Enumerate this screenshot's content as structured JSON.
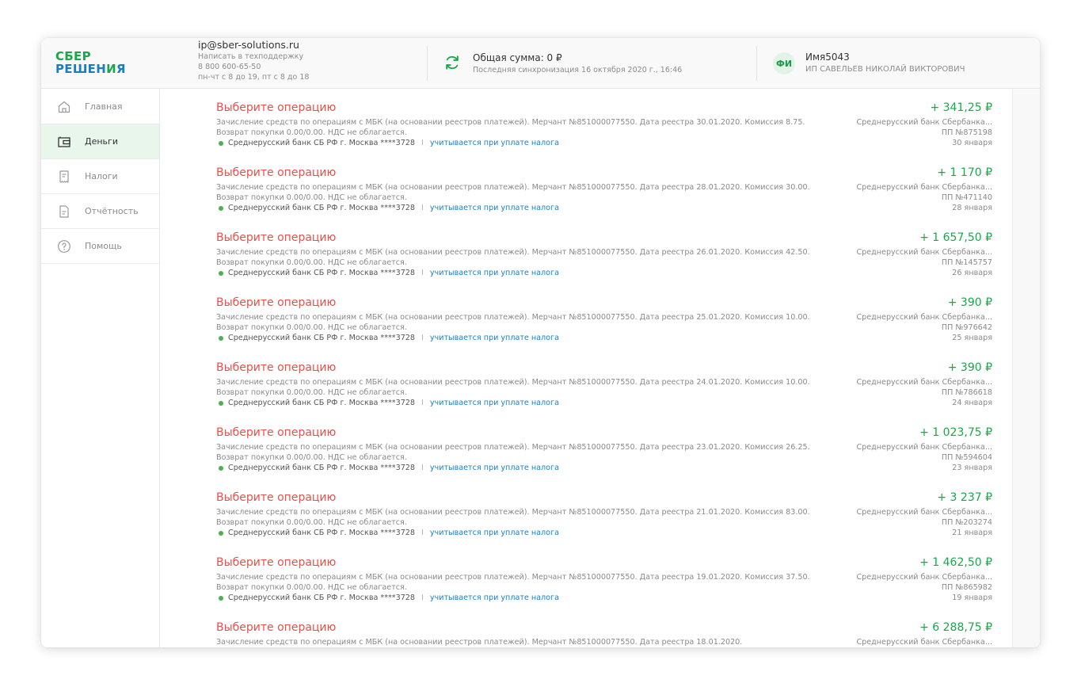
{
  "logo": {
    "line1": "СБЕР",
    "line2a": "РЕШЕН",
    "line2b": "И",
    "line2c": "Я"
  },
  "contacts": {
    "email": "ip@sber-solutions.ru",
    "support": "Написать в техподдержку",
    "phone": "8 800 600-65-50",
    "hours": "пн-чт с 8 до 19, пт с 8 до 18"
  },
  "sync": {
    "total": "Общая сумма: 0 ₽",
    "last": "Последняя синхронизация 16 октября 2020 г., 16:46"
  },
  "user": {
    "initials": "ФИ",
    "name": "Имя5043",
    "org": "ИП САВЕЛЬЕВ НИКОЛАЙ ВИКТОРОВИЧ"
  },
  "sidebar": {
    "items": [
      {
        "label": "Главная",
        "icon": "home-icon"
      },
      {
        "label": "Деньги",
        "icon": "wallet-icon"
      },
      {
        "label": "Налоги",
        "icon": "receipt-icon"
      },
      {
        "label": "Отчётность",
        "icon": "document-icon"
      },
      {
        "label": "Помощь",
        "icon": "help-icon"
      }
    ]
  },
  "colors": {
    "accent_green": "#18a84a",
    "title_red": "#e8504b",
    "link_blue": "#1a7fc1"
  },
  "operations": [
    {
      "title": "Выберите операцию",
      "desc": "Зачисление средств по операциям с МБК (на основании реестров платежей). Мерчант №851000077550. Дата реестра 30.01.2020. Комиссия 8.75. Возврат покупки 0.00/0.00. НДС не облагается.",
      "account": "Среднерусский банк СБ РФ г. Москва ****3728",
      "sep": "I",
      "tax": "учитывается при уплате налога",
      "amount": "+ 341,25 ₽",
      "bank": "Среднерусский банк Сбербанка...",
      "pp": "ПП №875198",
      "date": "30 января"
    },
    {
      "title": "Выберите операцию",
      "desc": "Зачисление средств по операциям с МБК (на основании реестров платежей). Мерчант №851000077550. Дата реестра 28.01.2020. Комиссия 30.00. Возврат покупки 0.00/0.00. НДС не облагается.",
      "account": "Среднерусский банк СБ РФ г. Москва ****3728",
      "sep": "I",
      "tax": "учитывается при уплате налога",
      "amount": "+ 1 170 ₽",
      "bank": "Среднерусский банк Сбербанка...",
      "pp": "ПП №471140",
      "date": "28 января"
    },
    {
      "title": "Выберите операцию",
      "desc": "Зачисление средств по операциям с МБК (на основании реестров платежей). Мерчант №851000077550. Дата реестра 26.01.2020. Комиссия 42.50. Возврат покупки 0.00/0.00. НДС не облагается.",
      "account": "Среднерусский банк СБ РФ г. Москва ****3728",
      "sep": "I",
      "tax": "учитывается при уплате налога",
      "amount": "+ 1 657,50 ₽",
      "bank": "Среднерусский банк Сбербанка...",
      "pp": "ПП №145757",
      "date": "26 января"
    },
    {
      "title": "Выберите операцию",
      "desc": "Зачисление средств по операциям с МБК (на основании реестров платежей). Мерчант №851000077550. Дата реестра 25.01.2020. Комиссия 10.00. Возврат покупки 0.00/0.00. НДС не облагается.",
      "account": "Среднерусский банк СБ РФ г. Москва ****3728",
      "sep": "I",
      "tax": "учитывается при уплате налога",
      "amount": "+ 390 ₽",
      "bank": "Среднерусский банк Сбербанка...",
      "pp": "ПП №976642",
      "date": "25 января"
    },
    {
      "title": "Выберите операцию",
      "desc": "Зачисление средств по операциям с МБК (на основании реестров платежей). Мерчант №851000077550. Дата реестра 24.01.2020. Комиссия 10.00. Возврат покупки 0.00/0.00. НДС не облагается.",
      "account": "Среднерусский банк СБ РФ г. Москва ****3728",
      "sep": "I",
      "tax": "учитывается при уплате налога",
      "amount": "+ 390 ₽",
      "bank": "Среднерусский банк Сбербанка...",
      "pp": "ПП №786618",
      "date": "24 января"
    },
    {
      "title": "Выберите операцию",
      "desc": "Зачисление средств по операциям с МБК (на основании реестров платежей). Мерчант №851000077550. Дата реестра 23.01.2020. Комиссия 26.25. Возврат покупки 0.00/0.00. НДС не облагается.",
      "account": "Среднерусский банк СБ РФ г. Москва ****3728",
      "sep": "I",
      "tax": "учитывается при уплате налога",
      "amount": "+ 1 023,75 ₽",
      "bank": "Среднерусский банк Сбербанка...",
      "pp": "ПП №594604",
      "date": "23 января"
    },
    {
      "title": "Выберите операцию",
      "desc": "Зачисление средств по операциям с МБК (на основании реестров платежей). Мерчант №851000077550. Дата реестра 21.01.2020. Комиссия 83.00. Возврат покупки 0.00/0.00. НДС не облагается.",
      "account": "Среднерусский банк СБ РФ г. Москва ****3728",
      "sep": "I",
      "tax": "учитывается при уплате налога",
      "amount": "+ 3 237 ₽",
      "bank": "Среднерусский банк Сбербанка...",
      "pp": "ПП №203274",
      "date": "21 января"
    },
    {
      "title": "Выберите операцию",
      "desc": "Зачисление средств по операциям с МБК (на основании реестров платежей). Мерчант №851000077550. Дата реестра 19.01.2020. Комиссия 37.50. Возврат покупки 0.00/0.00. НДС не облагается.",
      "account": "Среднерусский банк СБ РФ г. Москва ****3728",
      "sep": "I",
      "tax": "учитывается при уплате налога",
      "amount": "+ 1 462,50 ₽",
      "bank": "Среднерусский банк Сбербанка...",
      "pp": "ПП №865982",
      "date": "19 января"
    },
    {
      "title": "Выберите операцию",
      "desc": "Зачисление средств по операциям с МБК (на основании реестров платежей). Мерчант №851000077550. Дата реестра 18.01.2020.",
      "account": "",
      "sep": "",
      "tax": "",
      "amount": "+ 6 288,75 ₽",
      "bank": "Среднерусский банк Сбербанка...",
      "pp": "",
      "date": ""
    }
  ]
}
